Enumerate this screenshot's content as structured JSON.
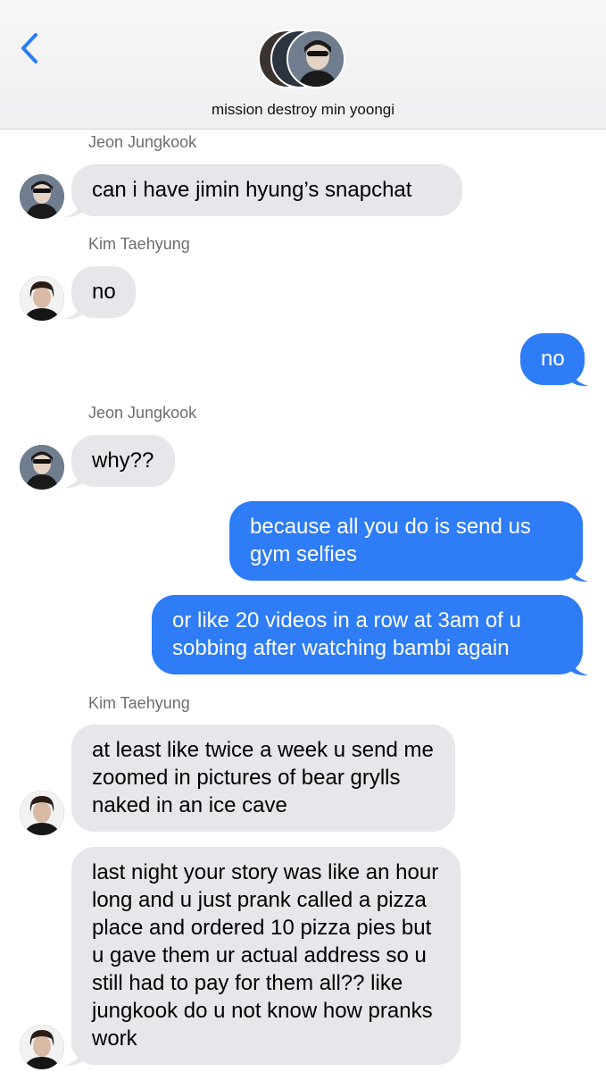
{
  "header": {
    "back_icon": "chevron-left-icon",
    "group_name": "mission destroy min yoongi",
    "accent": "#2e7cf6"
  },
  "messages": [
    {
      "sender": "Jeon Jungkook",
      "direction": "incoming",
      "text": "can i have jimin hyung’s snapchat"
    },
    {
      "sender": "Kim Taehyung",
      "direction": "incoming",
      "text": "no"
    },
    {
      "sender": "",
      "direction": "outgoing",
      "text": "no"
    },
    {
      "sender": "Jeon Jungkook",
      "direction": "incoming",
      "text": "why??"
    },
    {
      "sender": "",
      "direction": "outgoing",
      "text": "because all you do is send us gym selfies"
    },
    {
      "sender": "",
      "direction": "outgoing",
      "text": "or like 20 videos in a row at 3am of u sobbing after watching bambi again"
    },
    {
      "sender": "Kim Taehyung",
      "direction": "incoming",
      "text": "at least like twice a week u send me zoomed in pictures of bear grylls naked in an ice cave"
    },
    {
      "sender": "",
      "direction": "incoming",
      "text": "last night your story was like an hour long and u just prank called a pizza place and ordered 10 pizza pies but u gave them ur actual address so u still had to pay for them all?? like jungkook do u not know how pranks work"
    }
  ],
  "colors": {
    "incoming_bubble": "#e6e6eb",
    "outgoing_bubble": "#2e7cf6",
    "sender_label": "#6d6d72"
  }
}
